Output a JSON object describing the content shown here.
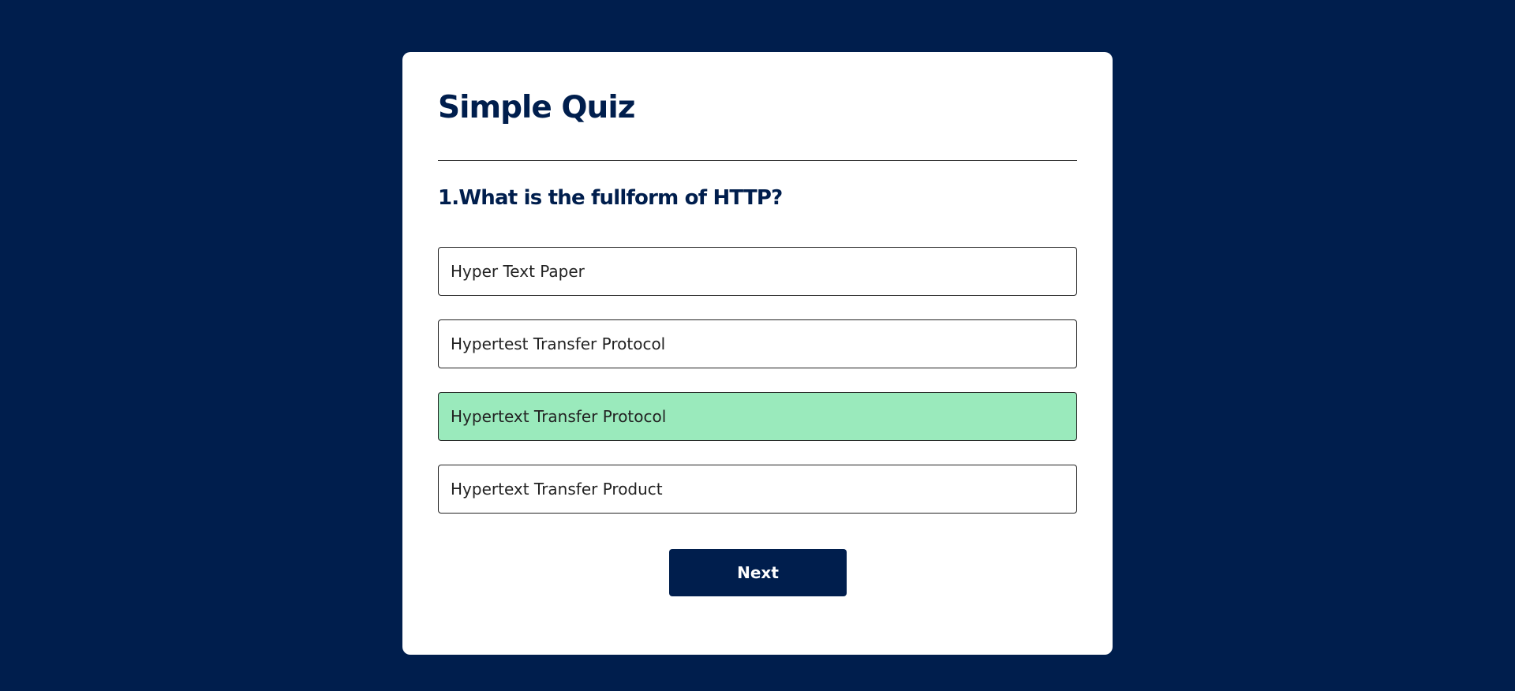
{
  "quiz": {
    "title": "Simple Quiz",
    "question": "1.What is the fullform of HTTP?",
    "answers": [
      {
        "label": "Hyper Text Paper",
        "state": "default"
      },
      {
        "label": "Hypertest Transfer Protocol",
        "state": "default"
      },
      {
        "label": "Hypertext Transfer Protocol",
        "state": "correct"
      },
      {
        "label": "Hypertext Transfer Product",
        "state": "default"
      }
    ],
    "next_label": "Next"
  },
  "colors": {
    "background": "#001e4d",
    "card": "#ffffff",
    "accent": "#001e4d",
    "correct": "#9aeabc"
  }
}
